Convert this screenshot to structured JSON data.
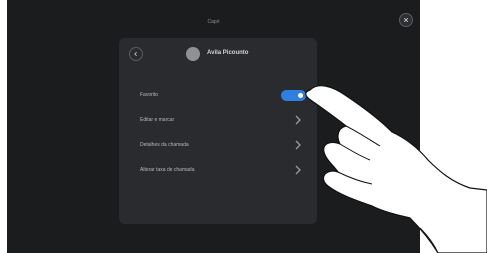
{
  "header": {
    "title": "Capri"
  },
  "icons": {
    "close": "close-icon",
    "back": "arrow-left-icon",
    "chevron": "chevron-right-icon"
  },
  "contact": {
    "name": "Avila Picounto"
  },
  "menu": {
    "favorite_label": "Favorito",
    "favorite_on": true,
    "edit_label": "Editar e marcar",
    "details_label": "Detalhes da chamada",
    "quality_label": "Alterar taxa de chamada"
  },
  "colors": {
    "screen_bg": "#1b1c1e",
    "panel_bg": "#2a2b2e",
    "toggle_on": "#2f7fe0"
  }
}
